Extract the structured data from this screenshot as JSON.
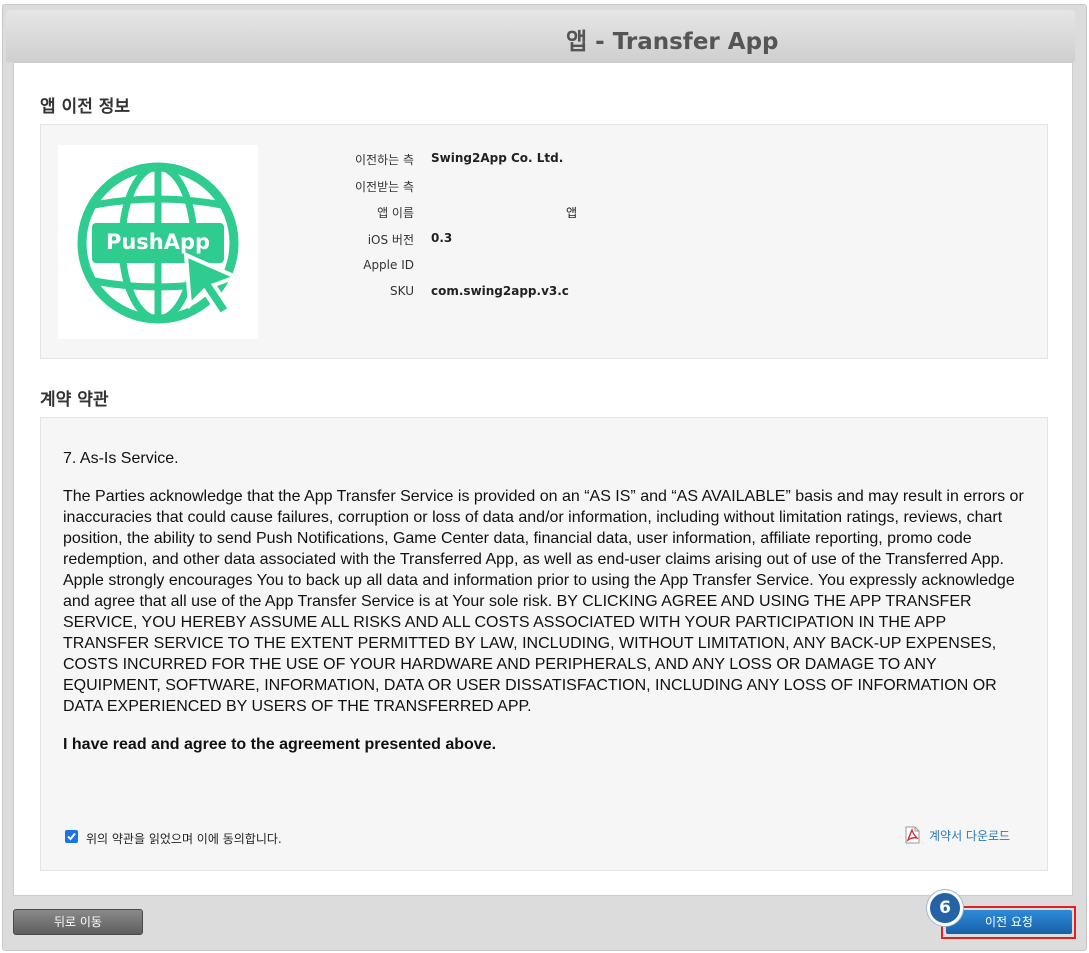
{
  "window": {
    "title": "앱 - Transfer App"
  },
  "app_info": {
    "section_title": "앱 이전 정보",
    "icon_text": "PushApp",
    "rows": [
      {
        "label": "이전하는 측",
        "value": "Swing2App Co. Ltd."
      },
      {
        "label": "이전받는 측",
        "value": ""
      },
      {
        "label": "앱 이름",
        "value": "앱"
      },
      {
        "label": "iOS 버전",
        "value": "0.3"
      },
      {
        "label": "Apple ID",
        "value": ""
      },
      {
        "label": "SKU",
        "value": "com.swing2app.v3.c"
      }
    ]
  },
  "terms": {
    "section_title": "계약 약관",
    "heading": "7. As-Is Service.",
    "body": "The Parties acknowledge that the App Transfer Service is provided on an “AS IS” and “AS AVAILABLE” basis and may result in errors or inaccuracies that could cause failures, corruption or loss of data and/or information, including without limitation ratings, reviews, chart position, the ability to send Push Notifications, Game Center data, financial data, user information, affiliate reporting, promo code redemption, and other data associated with the Transferred App, as well as end-user claims arising out of use of the Transferred App. Apple strongly encourages You to back up all data and information prior to using the App Transfer Service. You expressly acknowledge and agree that all use of the App Transfer Service is at Your sole risk. BY CLICKING AGREE AND USING THE APP TRANSFER SERVICE, YOU HEREBY ASSUME ALL RISKS AND ALL COSTS ASSOCIATED WITH YOUR PARTICIPATION IN THE APP TRANSFER SERVICE TO THE EXTENT PERMITTED BY LAW, INCLUDING, WITHOUT LIMITATION, ANY BACK-UP EXPENSES, COSTS INCURRED FOR THE USE OF YOUR HARDWARE AND PERIPHERALS, AND ANY LOSS OR DAMAGE TO ANY EQUIPMENT, SOFTWARE, INFORMATION, DATA OR USER DISSATISFACTION, INCLUDING ANY LOSS OF INFORMATION OR DATA EXPERIENCED BY USERS OF THE TRANSFERRED APP.",
    "agreement": "I have read and agree to the agreement presented above.",
    "checkbox_label": "위의 약관을 읽었으며 이에 동의합니다.",
    "checkbox_checked": true,
    "download_label": "계약서 다운로드"
  },
  "footer": {
    "back_label": "뒤로 이동",
    "transfer_label": "이전 요청",
    "step_badge": "6"
  },
  "colors": {
    "accent": "#2563a7",
    "icon_green": "#2ecc8f",
    "highlight": "#e0211f"
  }
}
